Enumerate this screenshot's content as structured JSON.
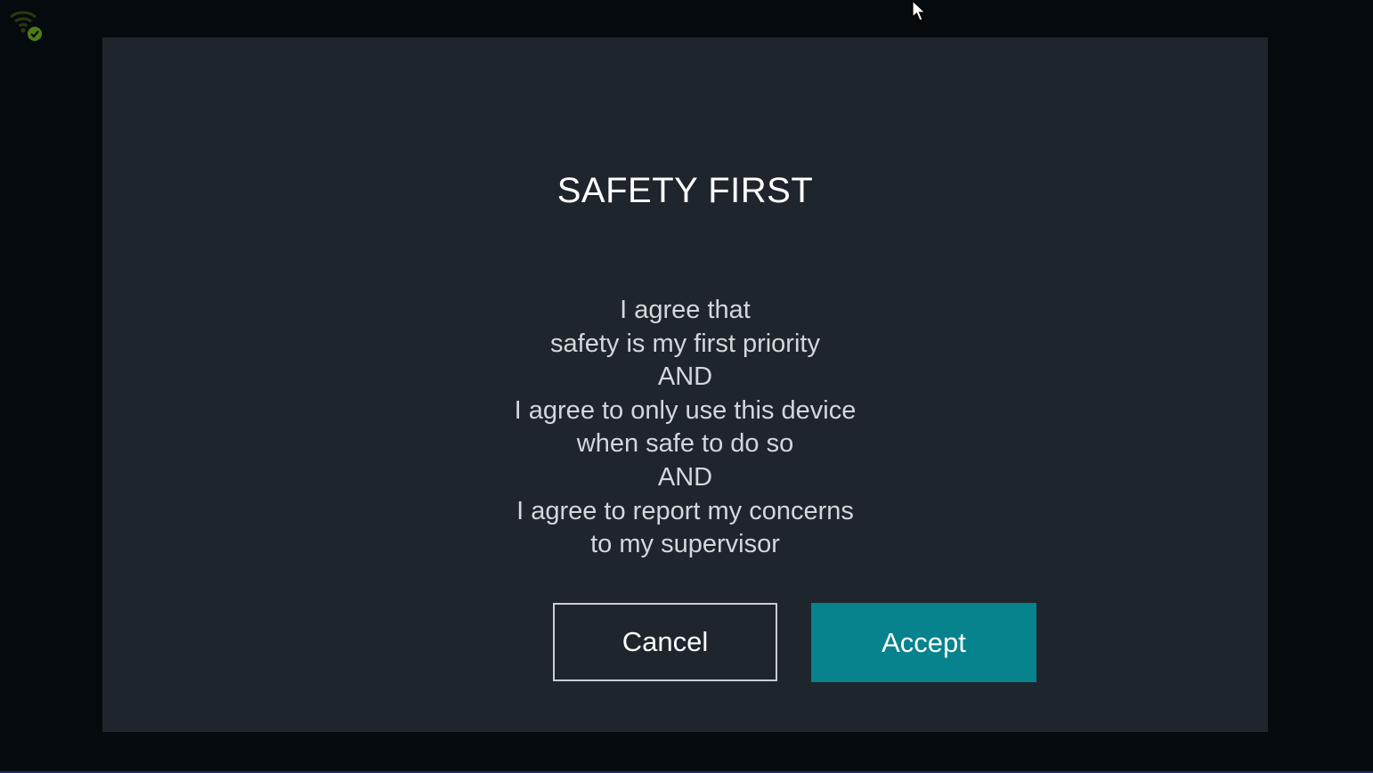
{
  "status_bar": {
    "wifi_icon": "wifi-connected-icon",
    "check_icon": "check-circle-icon",
    "wifi_color": "#2a3a10",
    "check_color": "#4e7d14"
  },
  "dialog": {
    "title": "SAFETY FIRST",
    "body_lines": [
      "I agree that",
      "safety is my first priority",
      "AND",
      "I agree to only use this device",
      "when safe to do so",
      "AND",
      "I agree to report my concerns",
      "to my supervisor"
    ],
    "cancel_label": "Cancel",
    "accept_label": "Accept",
    "accent_color": "#06838c",
    "background_color": "#1e252c"
  }
}
